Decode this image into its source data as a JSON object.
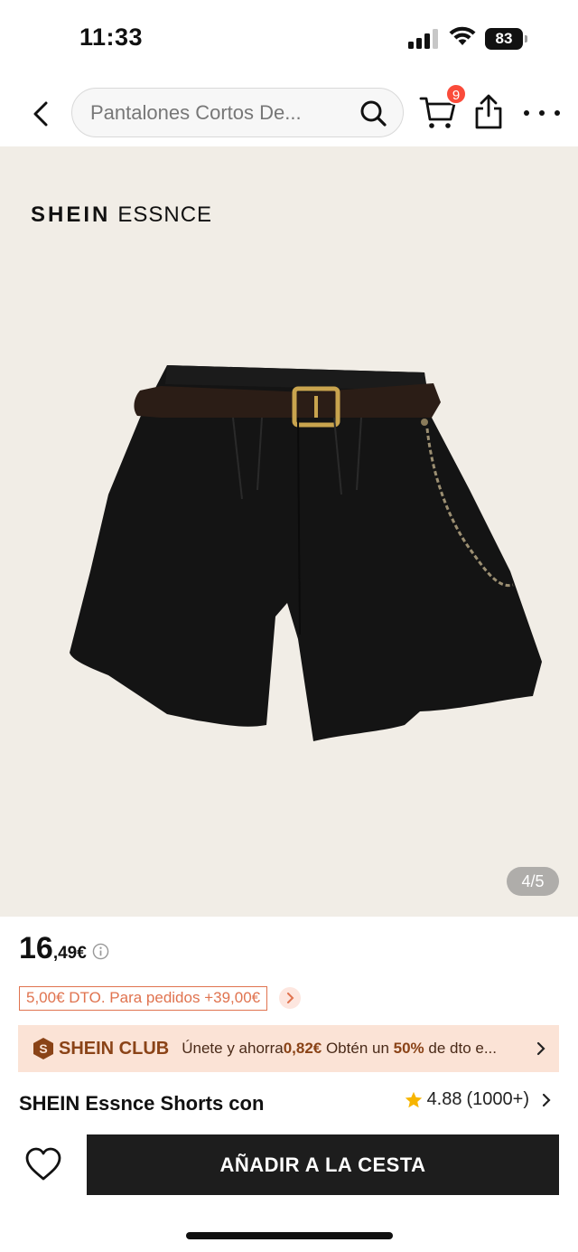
{
  "status_bar": {
    "time": "11:33",
    "battery": "83"
  },
  "nav": {
    "search_placeholder": "Pantalones Cortos De...",
    "cart_count": "9"
  },
  "product_image": {
    "brand": "SHEIN",
    "sub_brand": "ESSNCE",
    "counter": "4/5"
  },
  "price": {
    "integer": "16",
    "decimal": ",49€"
  },
  "coupon": {
    "label": "5,00€ DTO. Para pedidos +39,00€"
  },
  "club": {
    "name": "SHEIN CLUB",
    "msg_prefix": "Únete y ahorra",
    "msg_amount": "0,82€",
    "msg_mid": " Obtén un ",
    "msg_pct": "50%",
    "msg_suffix": " de dto e..."
  },
  "product": {
    "title": "SHEIN Essnce Shorts con",
    "rating": "4.88",
    "rating_count": "(1000+)"
  },
  "bottom_bar": {
    "add_to_cart_label": "AÑADIR A LA CESTA"
  },
  "colors": {
    "accent": "#e0734f",
    "club_bg": "#fbe3d6",
    "badge": "#fa4b3a",
    "button_bg": "#1d1d1d"
  }
}
